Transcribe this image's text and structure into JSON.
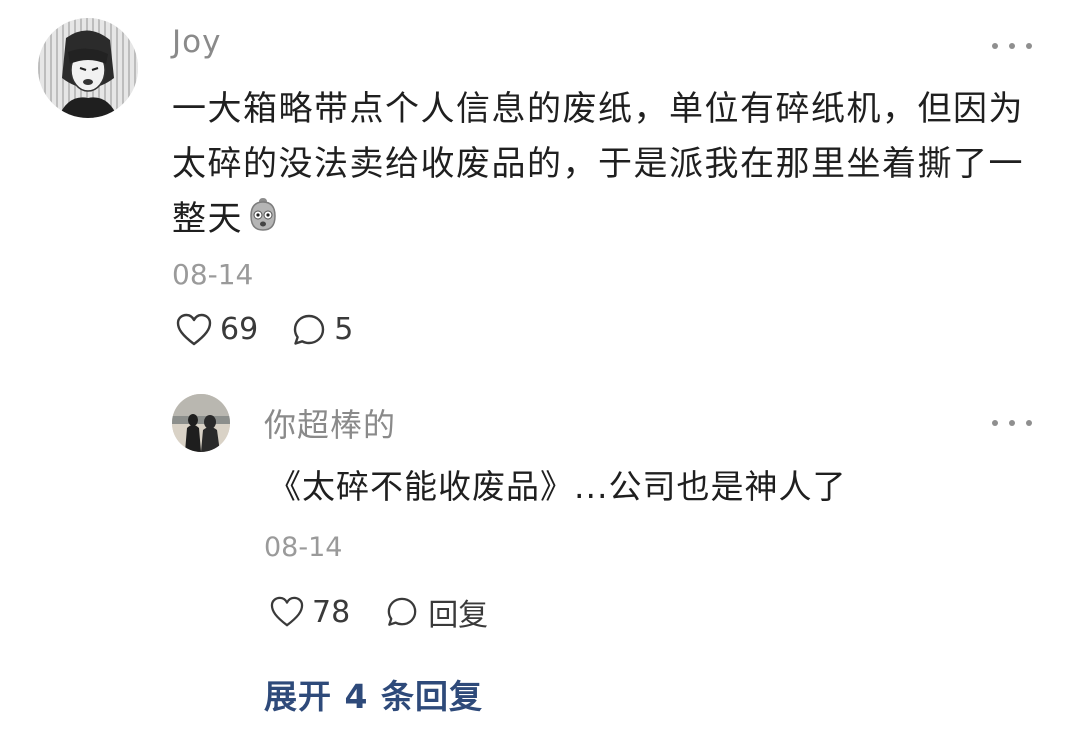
{
  "comment": {
    "author": "Joy",
    "text": "一大箱略带点个人信息的废纸，单位有碎纸机，但因为太碎的没法卖给收废品的，于是派我在那里坐着撕了一整天",
    "emoji_icon": "frightened-face-emoji",
    "date": "08-14",
    "likes": "69",
    "comments": "5",
    "more_icon": "more-dots-icon"
  },
  "reply": {
    "author": "你超棒的",
    "text": "《太碎不能收废品》...公司也是神人了",
    "date": "08-14",
    "likes": "78",
    "reply_label": "回复",
    "more_icon": "more-dots-icon"
  },
  "expand": {
    "label": "展开 4 条回复"
  },
  "colors": {
    "link": "#2e4a7a",
    "meta_text": "#9a9a9a",
    "author_text": "#8a8a8a",
    "body_text": "#1f1f1f"
  }
}
